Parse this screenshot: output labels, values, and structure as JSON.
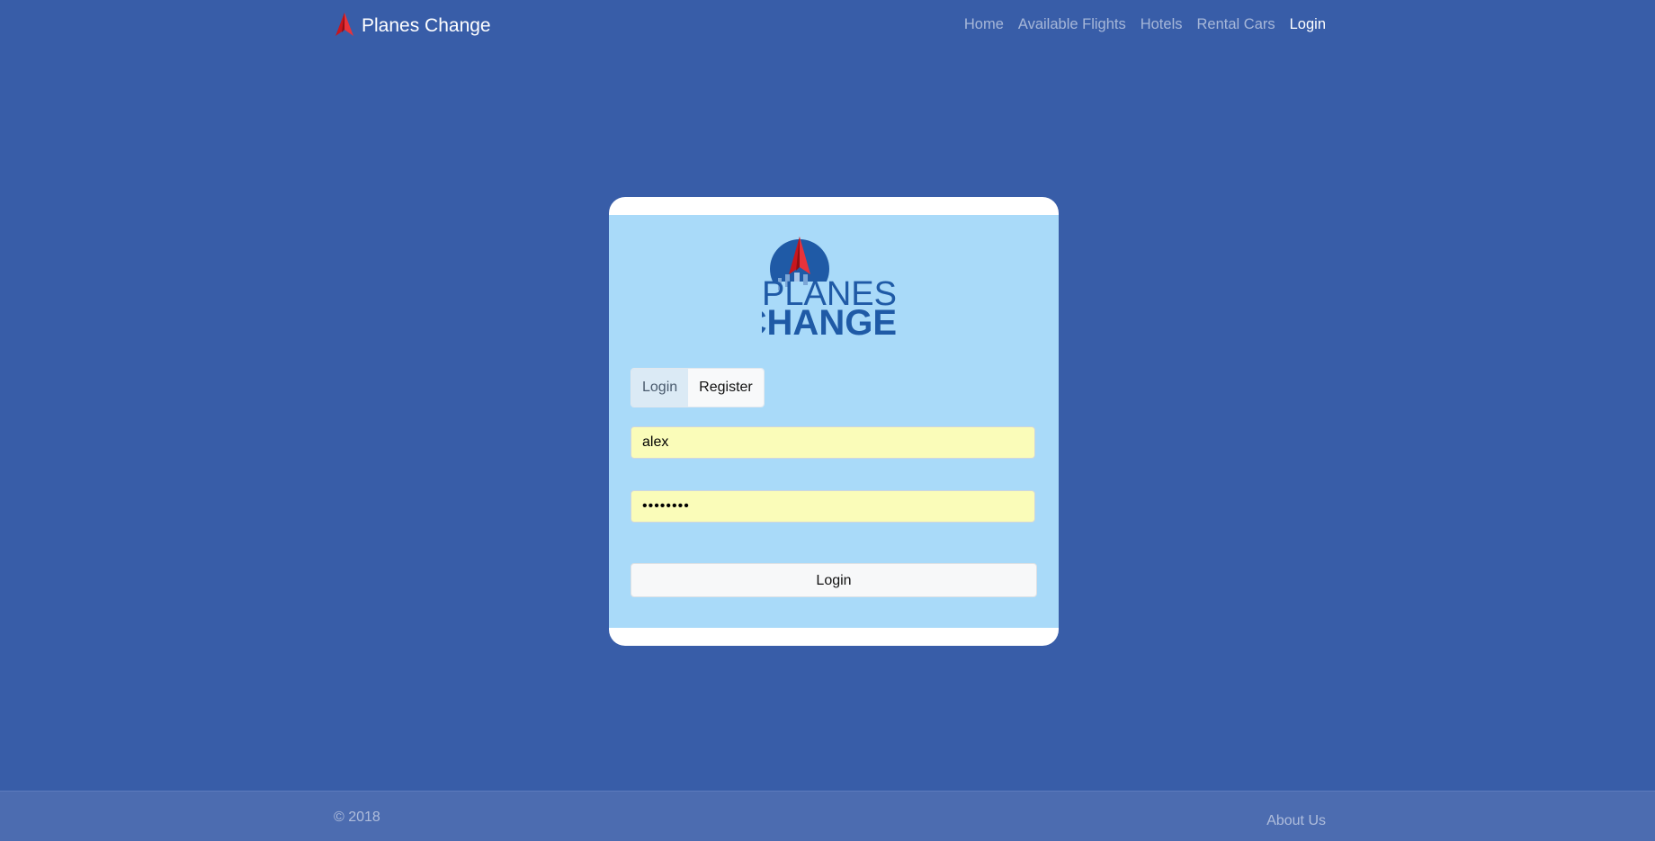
{
  "header": {
    "brand_name": "Planes Change",
    "brand_icon": "paper-plane-icon",
    "nav": [
      {
        "label": "Home"
      },
      {
        "label": "Available Flights"
      },
      {
        "label": "Hotels"
      },
      {
        "label": "Rental Cars"
      },
      {
        "label": "Login",
        "active": true
      }
    ]
  },
  "login_card": {
    "logo": {
      "line1": "PLANES",
      "line2": "CHANGE"
    },
    "tabs": [
      {
        "label": "Login",
        "active": true
      },
      {
        "label": "Register",
        "active": false
      }
    ],
    "username": {
      "value": "alex"
    },
    "password": {
      "value": "••••••••"
    },
    "submit_label": "Login"
  },
  "footer": {
    "copyright": "© 2018",
    "about_label": "About Us"
  },
  "colors": {
    "background": "#385da8",
    "card_panel": "#a9daf9",
    "autofill": "#fafcb9",
    "brand_red": "#d31f26",
    "logo_blue": "#1f5aa6"
  }
}
